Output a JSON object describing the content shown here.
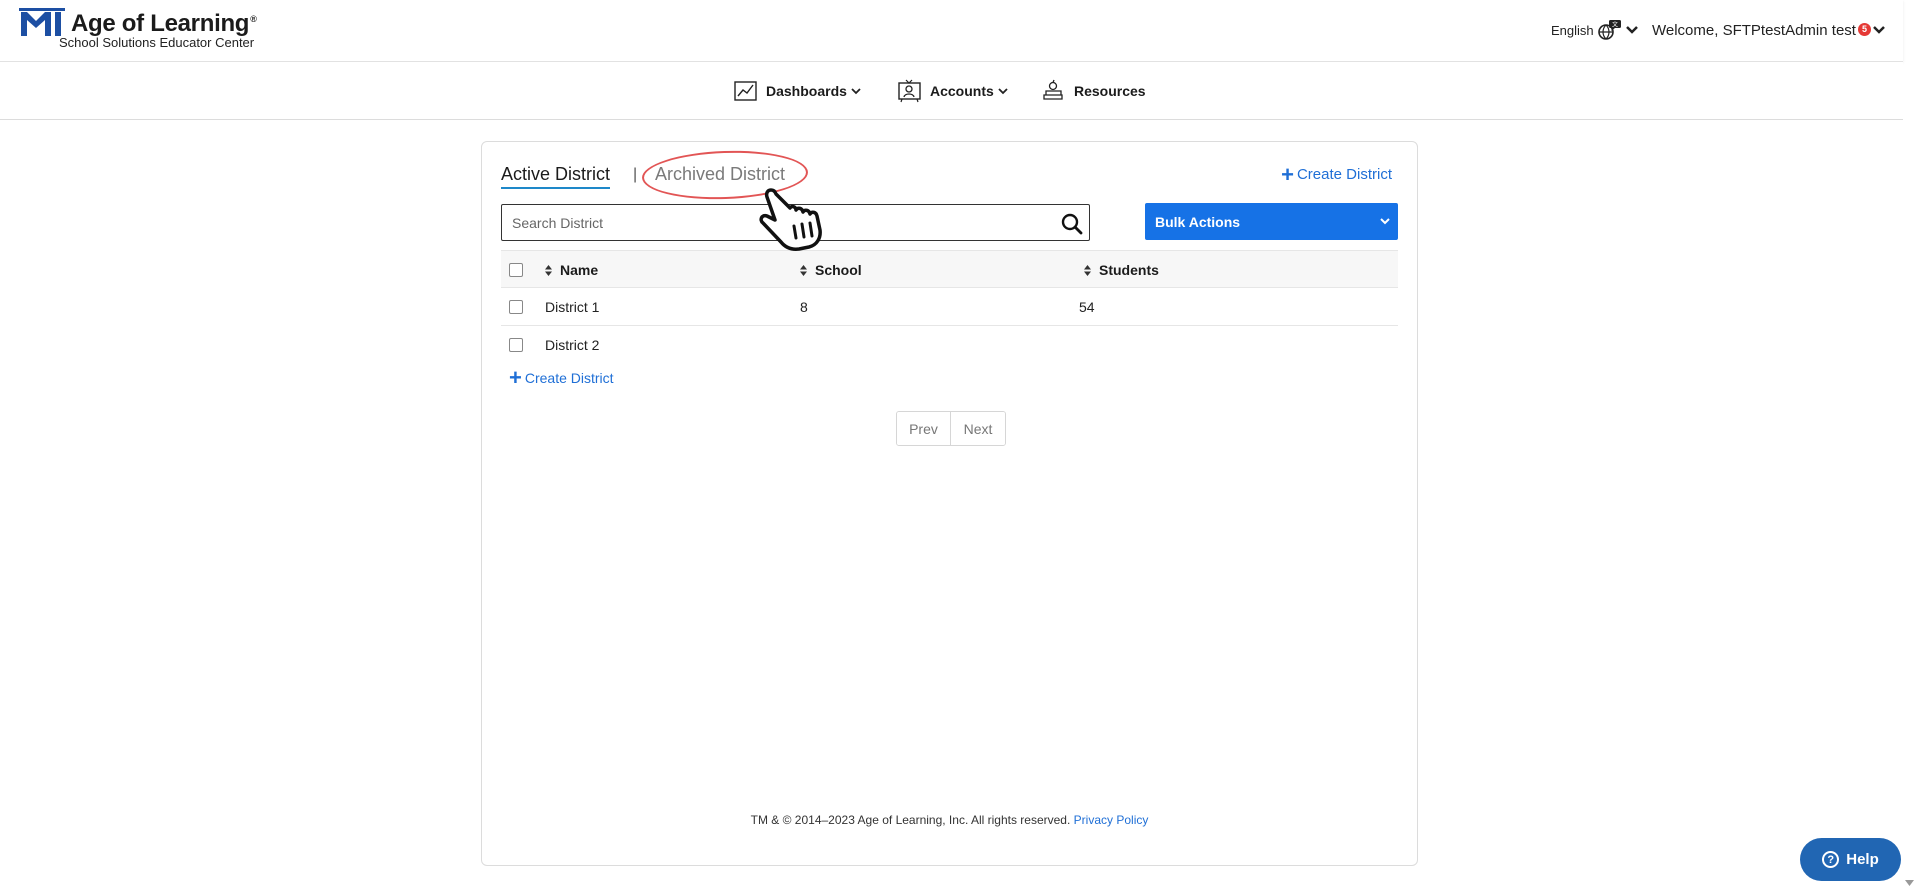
{
  "header": {
    "brand_title": "Age of Learning",
    "brand_tm": "®",
    "brand_subtitle": "School Solutions Educator Center",
    "language": "English",
    "welcome": "Welcome, SFTPtestAdmin test",
    "notification_count": "5"
  },
  "nav": {
    "items": [
      {
        "label": "Dashboards",
        "icon": "chart-line-icon"
      },
      {
        "label": "Accounts",
        "icon": "accounts-board-icon"
      },
      {
        "label": "Resources",
        "icon": "books-apple-icon"
      }
    ]
  },
  "tabs": {
    "active": "Active District",
    "separator": "|",
    "archived": "Archived District"
  },
  "actions": {
    "create_district": "Create District",
    "bulk_actions": "Bulk Actions"
  },
  "search": {
    "placeholder": "Search District",
    "value": ""
  },
  "table": {
    "columns": [
      "Name",
      "School",
      "Students"
    ],
    "rows": [
      {
        "name": "District 1",
        "school": "8",
        "students": "54"
      },
      {
        "name": "District 2",
        "school": "",
        "students": ""
      }
    ]
  },
  "pagination": {
    "prev": "Prev",
    "next": "Next"
  },
  "footer": {
    "copyright": "TM & © 2014–2023 Age of Learning, Inc. All rights reserved.",
    "privacy": "Privacy Policy"
  },
  "help": {
    "label": "Help",
    "icon_glyph": "?"
  },
  "colors": {
    "brand_blue": "#1d4fa3",
    "link_blue": "#1f6fd6",
    "primary_button": "#1672e6",
    "help_button": "#2166b3",
    "tab_underline": "#1e88c9",
    "highlight_ring": "#e25555",
    "badge_red": "#e53935"
  }
}
